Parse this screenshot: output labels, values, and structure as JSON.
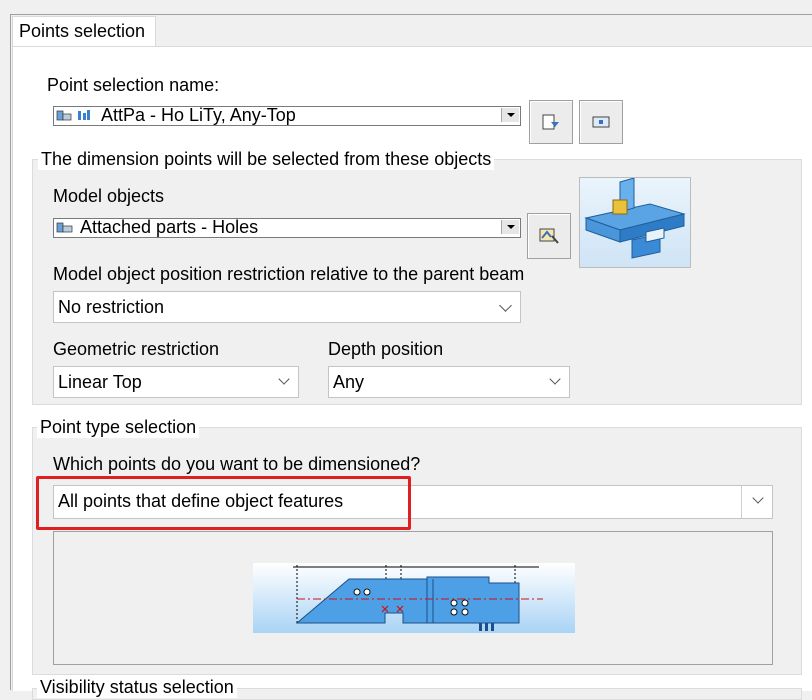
{
  "tab": {
    "label": "Points selection"
  },
  "point_selection": {
    "label": "Point selection name:",
    "value": "AttPa - Ho LiTy, Any-Top"
  },
  "objects_group": {
    "title": "The dimension points will be selected from these objects",
    "model_objects_label": "Model objects",
    "model_objects_value": "Attached parts - Holes",
    "position_restriction_label": "Model object position restriction relative to the parent beam",
    "position_restriction_value": "No restriction",
    "geometric_restriction_label": "Geometric restriction",
    "geometric_restriction_value": "Linear Top",
    "depth_position_label": "Depth position",
    "depth_position_value": "Any"
  },
  "point_type_group": {
    "title": "Point type selection",
    "question": "Which points do you want to be dimensioned?",
    "value": "All points that define object features"
  },
  "visibility_group": {
    "title": "Visibility status selection"
  },
  "colors": {
    "highlight": "#e02020",
    "preview_blue": "#3a8fd8",
    "dim_red": "#d01010"
  }
}
